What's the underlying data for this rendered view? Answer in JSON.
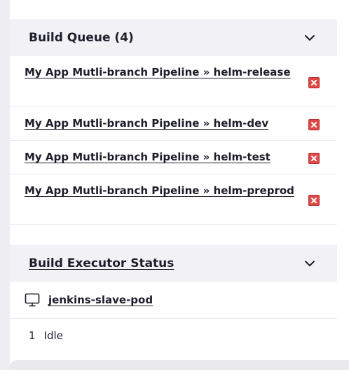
{
  "build_queue": {
    "title": "Build Queue (4)",
    "items": [
      {
        "label": "My App Mutli-branch Pipeline » helm-release"
      },
      {
        "label": "My App Mutli-branch Pipeline » helm-dev"
      },
      {
        "label": "My App Mutli-branch Pipeline » helm-test"
      },
      {
        "label": "My App Mutli-branch Pipeline » helm-preprod"
      }
    ]
  },
  "executor_status": {
    "title": "Build Executor Status",
    "node": {
      "name": "jenkins-slave-pod",
      "icon": "computer-icon"
    },
    "executors": [
      {
        "number": "1",
        "state": "Idle"
      }
    ]
  },
  "colors": {
    "header_bg": "#f2f2f6",
    "page_bg": "#e9e9ee",
    "cancel_red": "#e04848",
    "text": "#1d1d2b"
  }
}
